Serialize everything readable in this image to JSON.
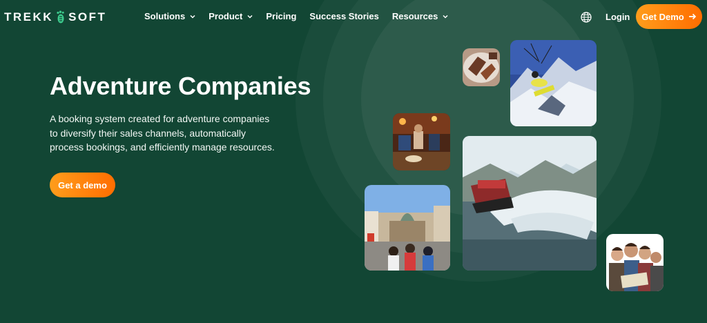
{
  "brand": {
    "logo_left": "TREKK",
    "logo_right": "SOFT"
  },
  "nav": {
    "items": [
      {
        "label": "Solutions",
        "dropdown": true
      },
      {
        "label": "Product",
        "dropdown": true
      },
      {
        "label": "Pricing",
        "dropdown": false
      },
      {
        "label": "Success Stories",
        "dropdown": false
      },
      {
        "label": "Resources",
        "dropdown": true
      }
    ],
    "language_icon": "globe-icon",
    "login_label": "Login",
    "demo_label": "Get Demo",
    "demo_icon": "arrow-right-icon"
  },
  "hero": {
    "title": "Adventure Companies",
    "description": "A booking system created for adventure companies to diversify their sales channels, automatically process bookings, and efficiently manage resources.",
    "cta_label": "Get a demo"
  },
  "colors": {
    "background": "#124634",
    "accent_start": "#ff9d1c",
    "accent_end": "#ff6d00",
    "text": "#ffffff"
  }
}
